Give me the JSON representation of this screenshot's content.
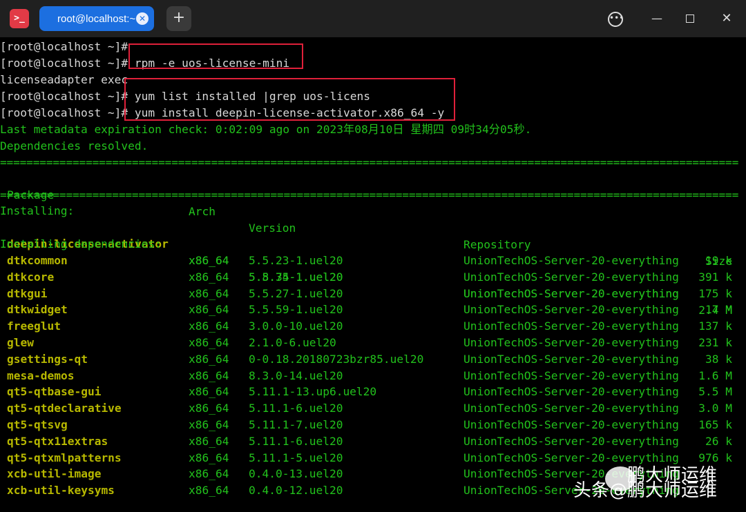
{
  "titlebar": {
    "app_icon": ">_",
    "tab_label": "root@localhost:~",
    "new_tab_symbol": "+",
    "menu_symbol": "•••",
    "close_symbol": "✕"
  },
  "terminal": {
    "prompt": "[root@localhost ~]#",
    "lines": {
      "l1": "",
      "l2_cmd": " rpm -e uos-license-mini",
      "l3": "licenseadapter exec",
      "l4_cmd": " yum list installed |grep uos-licens",
      "l5_cmd": " yum install deepin-license-activator.x86_64 -y",
      "l6": "Last metadata expiration check: 0:02:09 ago on 2023年08月10日 星期四 09时34分05秒.",
      "l7": "Dependencies resolved."
    },
    "separator": "================================================================================================================",
    "headers": {
      "package": "Package",
      "arch": "Arch",
      "version": "Version",
      "repository": "Repository",
      "size": "Size"
    },
    "installing_label": "Installing:",
    "deps_label": "Installing dependencies:",
    "main_package": {
      "name": "deepin-license-activator",
      "arch": "x86_64",
      "version": "5.8.74-1.uel20",
      "repo": "UnionTechOS-Server-20-everything",
      "size": "2.4 M"
    },
    "deps": [
      {
        "name": "dtkcommon",
        "arch": "x86_64",
        "version": "5.5.23-1.uel20",
        "repo": "UnionTechOS-Server-20-everything",
        "size": "19 k"
      },
      {
        "name": "dtkcore",
        "arch": "x86_64",
        "version": "5.5.35-1.uel20",
        "repo": "UnionTechOS-Server-20-everything",
        "size": "391 k"
      },
      {
        "name": "dtkgui",
        "arch": "x86_64",
        "version": "5.5.27-1.uel20",
        "repo": "UnionTechOS-Server-20-everything",
        "size": "175 k"
      },
      {
        "name": "dtkwidget",
        "arch": "x86_64",
        "version": "5.5.59-1.uel20",
        "repo": "UnionTechOS-Server-20-everything",
        "size": "17 M"
      },
      {
        "name": "freeglut",
        "arch": "x86_64",
        "version": "3.0.0-10.uel20",
        "repo": "UnionTechOS-Server-20-everything",
        "size": "137 k"
      },
      {
        "name": "glew",
        "arch": "x86_64",
        "version": "2.1.0-6.uel20",
        "repo": "UnionTechOS-Server-20-everything",
        "size": "231 k"
      },
      {
        "name": "gsettings-qt",
        "arch": "x86_64",
        "version": "0-0.18.20180723bzr85.uel20",
        "repo": "UnionTechOS-Server-20-everything",
        "size": "38 k"
      },
      {
        "name": "mesa-demos",
        "arch": "x86_64",
        "version": "8.3.0-14.uel20",
        "repo": "UnionTechOS-Server-20-everything",
        "size": "1.6 M"
      },
      {
        "name": "qt5-qtbase-gui",
        "arch": "x86_64",
        "version": "5.11.1-13.up6.uel20",
        "repo": "UnionTechOS-Server-20-everything",
        "size": "5.5 M"
      },
      {
        "name": "qt5-qtdeclarative",
        "arch": "x86_64",
        "version": "5.11.1-6.uel20",
        "repo": "UnionTechOS-Server-20-everything",
        "size": "3.0 M"
      },
      {
        "name": "qt5-qtsvg",
        "arch": "x86_64",
        "version": "5.11.1-7.uel20",
        "repo": "UnionTechOS-Server-20-everything",
        "size": "165 k"
      },
      {
        "name": "qt5-qtx11extras",
        "arch": "x86_64",
        "version": "5.11.1-6.uel20",
        "repo": "UnionTechOS-Server-20-everything",
        "size": "26 k"
      },
      {
        "name": "qt5-qtxmlpatterns",
        "arch": "x86_64",
        "version": "5.11.1-5.uel20",
        "repo": "UnionTechOS-Server-20-everything",
        "size": "976 k"
      },
      {
        "name": "xcb-util-image",
        "arch": "x86_64",
        "version": "0.4.0-13.uel20",
        "repo": "UnionTechOS-Server-20-everything",
        "size": ""
      },
      {
        "name": "xcb-util-keysyms",
        "arch": "x86_64",
        "version": "0.4.0-12.uel20",
        "repo": "UnionTechOS-Server-20-everything",
        "size": ""
      }
    ]
  },
  "watermark": {
    "source": "头条",
    "account": "@鹏大师运维",
    "wechat": "鹏大师运维"
  },
  "colors": {
    "highlight_box": "#e0203a",
    "tab_active": "#1c6fe0",
    "terminal_green": "#22c11c",
    "package_yellow": "#b7b800"
  }
}
